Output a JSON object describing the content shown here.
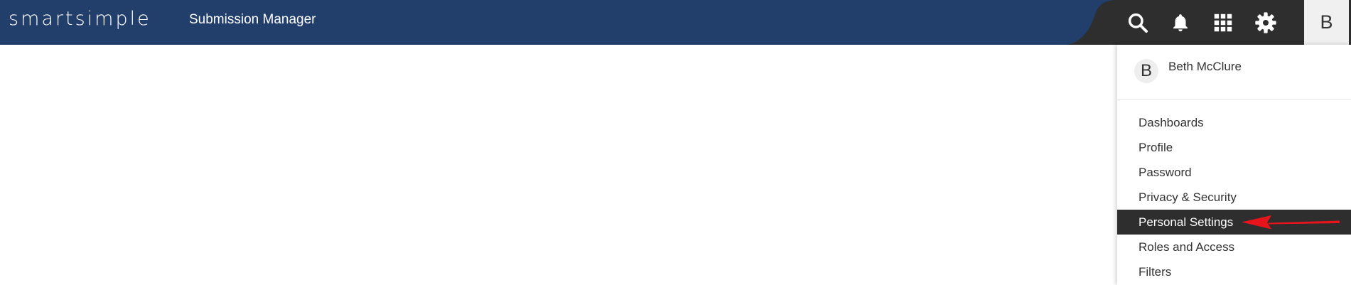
{
  "header": {
    "logo": "smartsimple",
    "app_title": "Submission Manager",
    "icons": [
      "search-icon",
      "bell-icon",
      "grid-icon",
      "gear-icon"
    ],
    "avatar_initial": "B",
    "bg_color": "#223f6c"
  },
  "user_menu": {
    "avatar_initial": "B",
    "user_name": "Beth McClure",
    "items": [
      {
        "label": "Dashboards"
      },
      {
        "label": "Profile"
      },
      {
        "label": "Password"
      },
      {
        "label": "Privacy & Security"
      },
      {
        "label": "Personal Settings",
        "active": true
      },
      {
        "label": "Roles and Access"
      },
      {
        "label": "Filters"
      }
    ]
  },
  "annotation": {
    "arrow_color": "#e8141b"
  }
}
